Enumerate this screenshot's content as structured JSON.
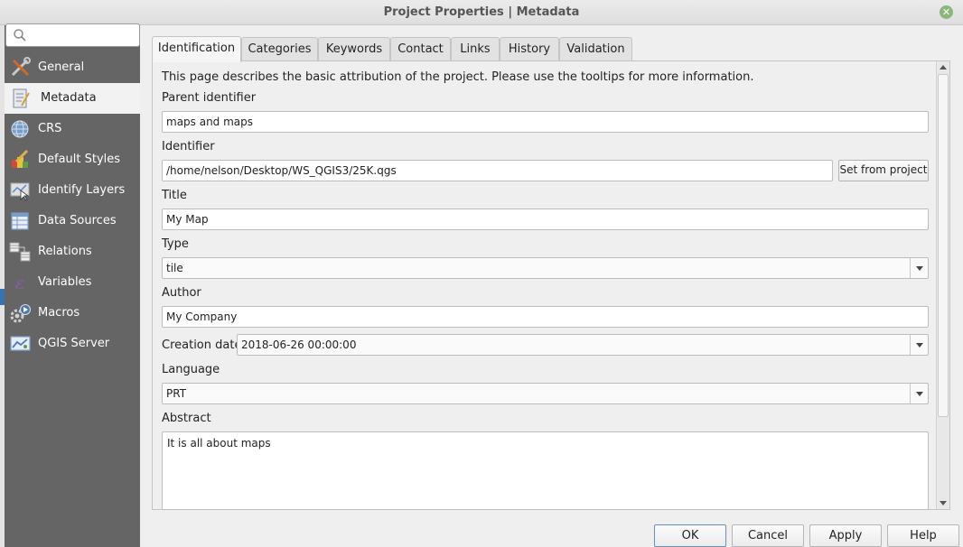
{
  "window": {
    "title": "Project Properties | Metadata"
  },
  "search": {
    "placeholder": ""
  },
  "sidebar": {
    "items": [
      {
        "label": "General",
        "icon": "tools-icon"
      },
      {
        "label": "Metadata",
        "icon": "metadata-icon",
        "active": true
      },
      {
        "label": "CRS",
        "icon": "globe-icon"
      },
      {
        "label": "Default Styles",
        "icon": "paintbrush-icon"
      },
      {
        "label": "Identify Layers",
        "icon": "identify-icon"
      },
      {
        "label": "Data Sources",
        "icon": "table-icon"
      },
      {
        "label": "Relations",
        "icon": "relations-icon"
      },
      {
        "label": "Variables",
        "icon": "variables-icon"
      },
      {
        "label": "Macros",
        "icon": "gear-icon"
      },
      {
        "label": "QGIS Server",
        "icon": "server-icon"
      }
    ]
  },
  "tabs": [
    {
      "label": "Identification",
      "active": true
    },
    {
      "label": "Categories"
    },
    {
      "label": "Keywords"
    },
    {
      "label": "Contact"
    },
    {
      "label": "Links"
    },
    {
      "label": "History"
    },
    {
      "label": "Validation"
    }
  ],
  "form": {
    "description": "This page describes the basic attribution of the project. Please use the tooltips for more information.",
    "parent_identifier": {
      "label": "Parent identifier",
      "value": "maps and maps"
    },
    "identifier": {
      "label": "Identifier",
      "value": "/home/nelson/Desktop/WS_QGIS3/25K.qgs",
      "button": "Set from project"
    },
    "title": {
      "label": "Title",
      "value": "My Map"
    },
    "type": {
      "label": "Type",
      "value": "tile"
    },
    "author": {
      "label": "Author",
      "value": "My Company"
    },
    "creation_date": {
      "label": "Creation date",
      "value": "2018-06-26 00:00:00"
    },
    "language": {
      "label": "Language",
      "value": "PRT"
    },
    "abstract": {
      "label": "Abstract",
      "value": "It is all about maps"
    }
  },
  "buttons": {
    "ok": "OK",
    "cancel": "Cancel",
    "apply": "Apply",
    "help": "Help"
  },
  "colors": {
    "sidebar_bg": "#656565",
    "accent": "#3573b5",
    "close_button": "#8bb77d"
  }
}
